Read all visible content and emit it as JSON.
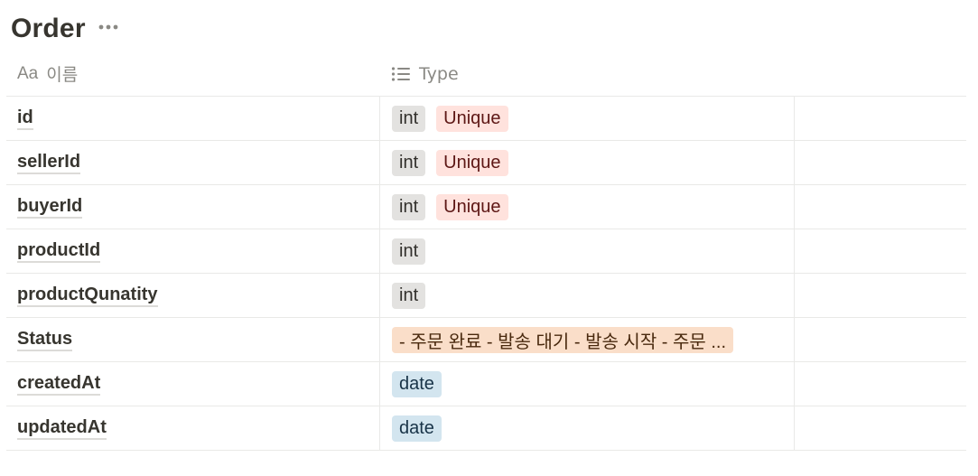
{
  "database": {
    "title": "Order"
  },
  "columns": {
    "name": "이름",
    "type": "Type"
  },
  "colors": {
    "gray": "#e3e2e0",
    "red": "#ffe2dd",
    "orange": "#fadec9",
    "blue": "#d3e5ef"
  },
  "rows": [
    {
      "name": "id",
      "tags": [
        {
          "label": "int",
          "color": "gray"
        },
        {
          "label": "Unique",
          "color": "red"
        }
      ]
    },
    {
      "name": "sellerId",
      "tags": [
        {
          "label": "int",
          "color": "gray"
        },
        {
          "label": "Unique",
          "color": "red"
        }
      ]
    },
    {
      "name": "buyerId",
      "tags": [
        {
          "label": "int",
          "color": "gray"
        },
        {
          "label": "Unique",
          "color": "red"
        }
      ]
    },
    {
      "name": "productId",
      "tags": [
        {
          "label": "int",
          "color": "gray"
        }
      ]
    },
    {
      "name": "productQunatity",
      "tags": [
        {
          "label": "int",
          "color": "gray"
        }
      ]
    },
    {
      "name": "Status",
      "tags": [
        {
          "label": "- 주문 완료 - 발송 대기 - 발송 시작 - 주문 ...",
          "color": "orange"
        }
      ]
    },
    {
      "name": "createdAt",
      "tags": [
        {
          "label": "date",
          "color": "blue"
        }
      ]
    },
    {
      "name": "updatedAt",
      "tags": [
        {
          "label": "date",
          "color": "blue"
        }
      ]
    }
  ]
}
